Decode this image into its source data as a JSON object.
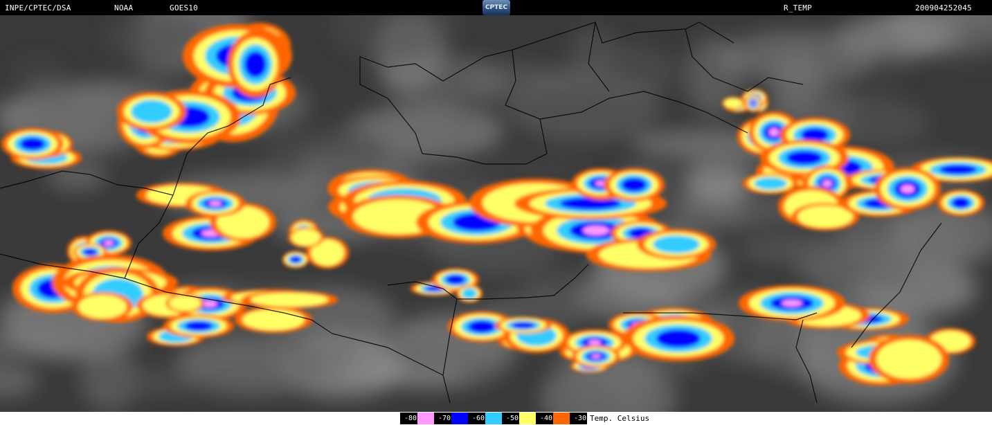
{
  "header": {
    "org": "INPE/CPTEC/DSA",
    "agency": "NOAA",
    "satellite": "GOES10",
    "logo_text": "CPTEC",
    "product": "R_TEMP",
    "timestamp": "200904252045"
  },
  "legend": {
    "title": "Temp. Celsius",
    "items": [
      {
        "label": "-80",
        "color": "#ff99ff"
      },
      {
        "label": "-70",
        "color": "#0000ff"
      },
      {
        "label": "-60",
        "color": "#33ccff"
      },
      {
        "label": "-50",
        "color": "#ffff66"
      },
      {
        "label": "-40",
        "color": "#ff6600"
      },
      {
        "label": "-30",
        "color": ""
      }
    ]
  },
  "map": {
    "background_color": "#3a3a3a",
    "border_color": "#000000"
  }
}
